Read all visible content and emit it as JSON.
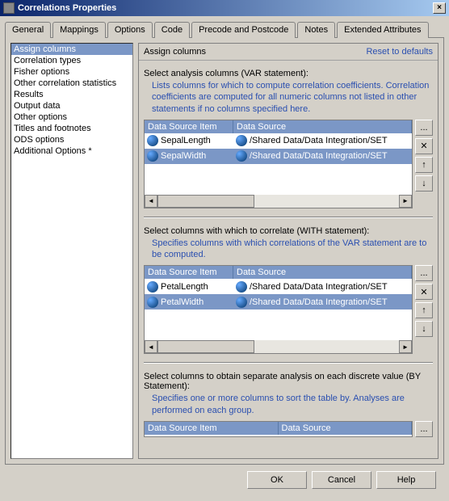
{
  "window": {
    "title": "Correlations Properties"
  },
  "tabs": [
    "General",
    "Mappings",
    "Options",
    "Code",
    "Precode and Postcode",
    "Notes",
    "Extended Attributes"
  ],
  "tab_active_index": 2,
  "sidebar": {
    "items": [
      "Assign columns",
      "Correlation types",
      "Fisher options",
      "Other correlation statistics",
      "Results",
      "Output data",
      "Other options",
      "Titles and footnotes",
      "ODS options",
      "Additional Options *"
    ],
    "selected_index": 0
  },
  "section": {
    "title": "Assign columns",
    "reset": "Reset to defaults"
  },
  "groups": [
    {
      "label": "Select analysis columns (VAR statement):",
      "help": "Lists columns for which to compute correlation coefficients. Correlation coefficients are computed for all numeric columns not listed in other statements if no columns specified here.",
      "columns": [
        "Data Source Item",
        "Data Source"
      ],
      "rows": [
        {
          "item": "SepalLength",
          "source": "/Shared Data/Data Integration/SET",
          "selected": false
        },
        {
          "item": "SepalWidth",
          "source": "/Shared Data/Data Integration/SET",
          "selected": true
        }
      ]
    },
    {
      "label": "Select columns with which to correlate (WITH statement):",
      "help": "Specifies columns with which correlations of the VAR statement are to be computed.",
      "columns": [
        "Data Source Item",
        "Data Source"
      ],
      "rows": [
        {
          "item": "PetalLength",
          "source": "/Shared Data/Data Integration/SET",
          "selected": false
        },
        {
          "item": "PetalWidth",
          "source": "/Shared Data/Data Integration/SET",
          "selected": true
        }
      ]
    },
    {
      "label": "Select columns to obtain separate analysis on each discrete value (BY Statement):",
      "help": "Specifies one or more columns to sort the table by. Analyses are performed on each group.",
      "columns": [
        "Data Source Item",
        "Data Source"
      ],
      "rows": []
    }
  ],
  "side_buttons": {
    "browse": "...",
    "delete": "✕",
    "up": "↑",
    "down": "↓"
  },
  "footer": {
    "ok": "OK",
    "cancel": "Cancel",
    "help": "Help"
  }
}
